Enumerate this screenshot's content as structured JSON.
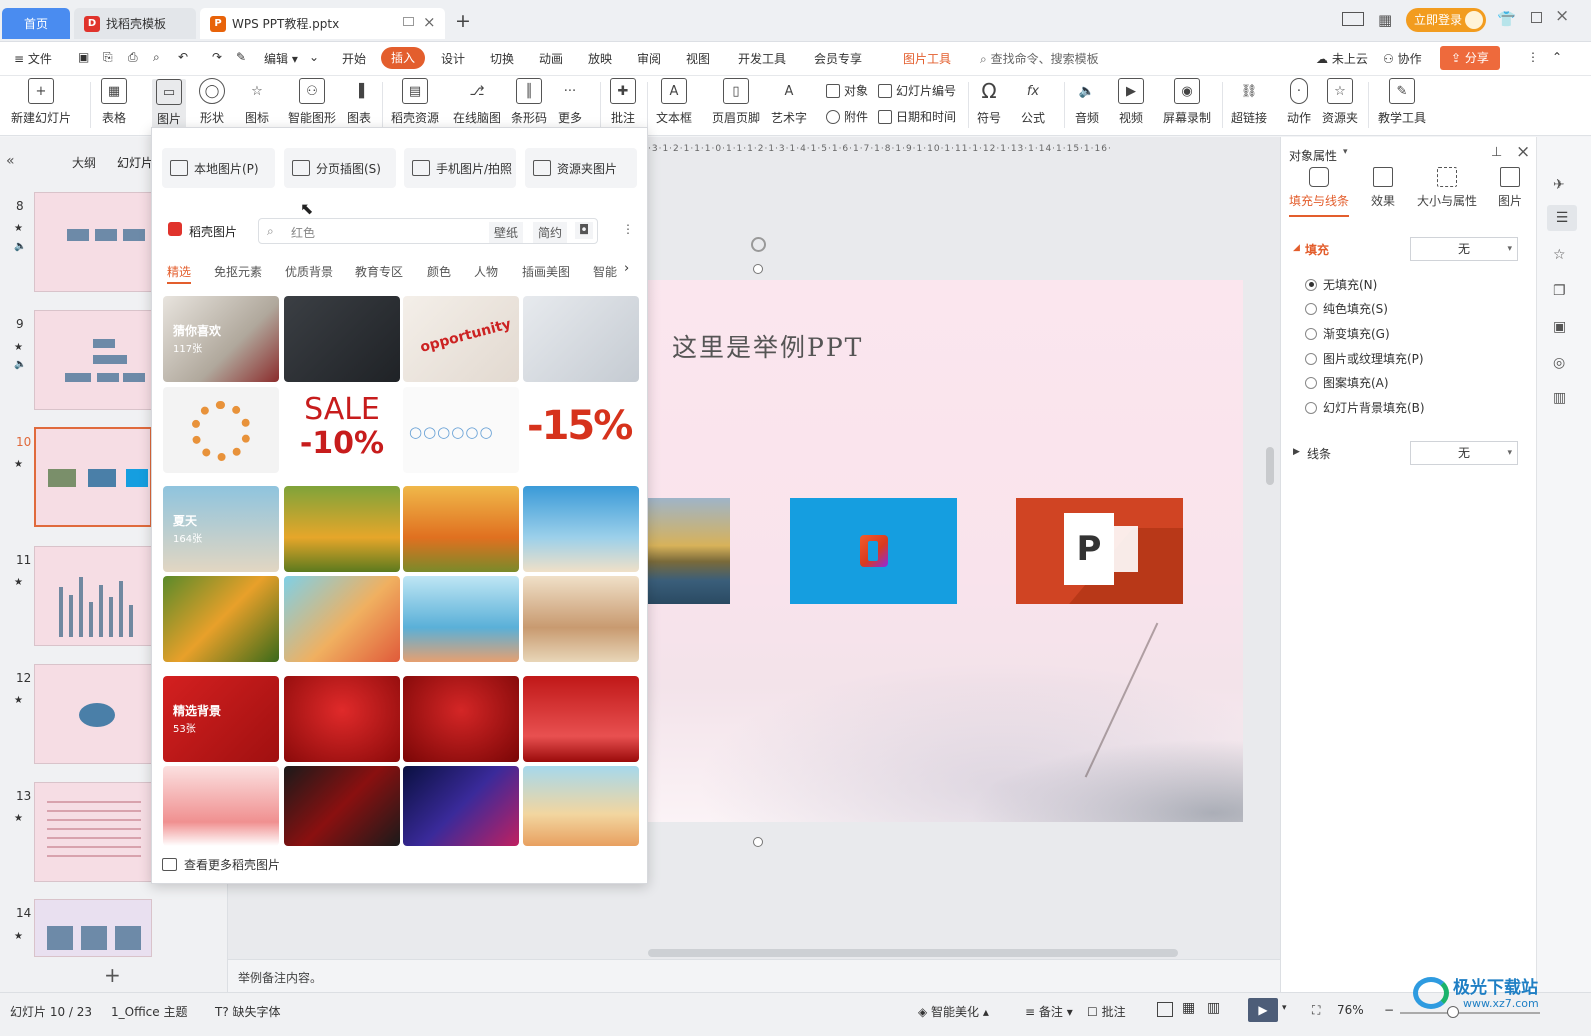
{
  "tabs": [
    {
      "label": "首页"
    },
    {
      "label": "找稻壳模板"
    },
    {
      "label": "WPS PPT教程.pptx"
    }
  ],
  "login": "立即登录",
  "menu": {
    "file": "文件",
    "edit": "编辑",
    "items": [
      "开始",
      "插入",
      "设计",
      "切换",
      "动画",
      "放映",
      "审阅",
      "视图",
      "开发工具",
      "会员专享"
    ],
    "active": "插入",
    "picture_tools": "图片工具",
    "search": "查找命令、搜索模板",
    "cloud": "未上云",
    "collab": "协作",
    "share": "分享"
  },
  "toolbar": {
    "items": [
      "新建幻灯片",
      "表格",
      "图片",
      "形状",
      "图标",
      "智能图形",
      "图表",
      "稻壳资源",
      "在线脑图",
      "条形码",
      "更多",
      "批注",
      "文本框",
      "页眉页脚",
      "艺术字"
    ],
    "obj": "对象",
    "attach": "附件",
    "slidenum": "幻灯片编号",
    "datetime": "日期和时间",
    "items2": [
      "符号",
      "公式",
      "音频",
      "视频",
      "屏幕录制",
      "超链接",
      "动作",
      "资源夹",
      "教学工具"
    ]
  },
  "leftpanel": {
    "outline": "大纲",
    "slides": "幻灯片",
    "numbers": [
      "8",
      "9",
      "10",
      "11",
      "12",
      "13",
      "14"
    ]
  },
  "popup": {
    "buttons": [
      "本地图片(P)",
      "分页插图(S)",
      "手机图片/拍照",
      "资源夹图片"
    ],
    "brand": "稻壳图片",
    "search_value": "红色",
    "tags": [
      "壁纸",
      "简约"
    ],
    "categories": [
      "精选",
      "免抠元素",
      "优质背景",
      "教育专区",
      "颜色",
      "人物",
      "插画美图",
      "智能"
    ],
    "groups": [
      {
        "label": "猜你喜欢",
        "count": "117张"
      },
      {
        "label": "夏天",
        "count": "164张"
      },
      {
        "label": "精选背景",
        "count": "53张"
      }
    ],
    "sale1": "SALE",
    "sale2": "-10%",
    "sale3": "-15%",
    "more": "查看更多稻壳图片"
  },
  "slide": {
    "title": "这里是举例PPT"
  },
  "ruler": "·3·1·2·1·1·1·0·1·1·1·2·1·3·1·4·1·5·1·6·1·7·1·8·1·9·1·10·1·11·1·12·1·13·1·14·1·15·1·16·",
  "rightpanel": {
    "title": "对象属性",
    "tabs": [
      "填充与线条",
      "效果",
      "大小与属性",
      "图片"
    ],
    "fill": "填充",
    "fill_value": "无",
    "options": [
      "无填充(N)",
      "纯色填充(S)",
      "渐变填充(G)",
      "图片或纹理填充(P)",
      "图案填充(A)",
      "幻灯片背景填充(B)"
    ],
    "line": "线条",
    "line_value": "无"
  },
  "notes": "举例备注内容。",
  "status": {
    "slide": "幻灯片 10 / 23",
    "theme": "1_Office 主题",
    "font": "缺失字体",
    "beautify": "智能美化",
    "notes": "备注",
    "comments": "批注",
    "zoom": "76%"
  },
  "watermark": {
    "text": "极光下载站",
    "url": "www.xz7.com"
  },
  "colors": {
    "accent": "#e35e2d",
    "wps_red": "#d93a1f",
    "blue_tile": "#159ee0",
    "ppt_orange": "#d04423"
  }
}
